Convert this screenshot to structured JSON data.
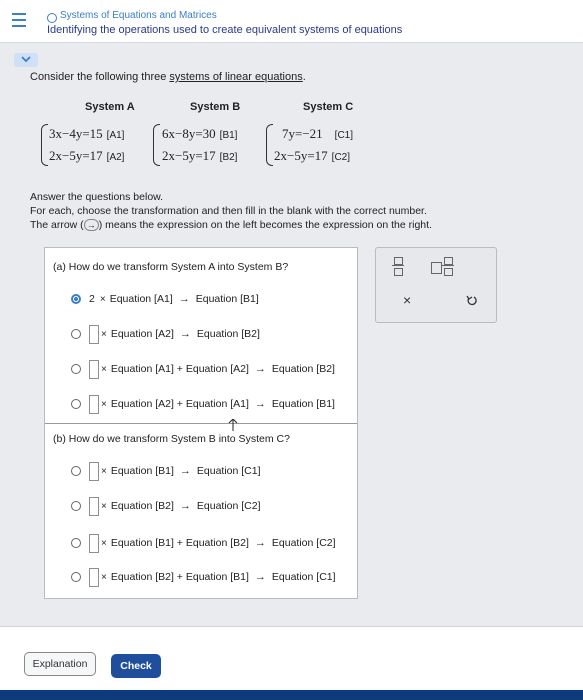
{
  "header": {
    "topic": "Systems of Equations and Matrices",
    "lesson": "Identifying the operations used to create equivalent systems of equations"
  },
  "intro": {
    "prefix": "Consider the following three ",
    "link": "systems of linear equations",
    "suffix": "."
  },
  "systems": [
    {
      "title": "System A",
      "eq1": "3x−4y=15",
      "tag1": "[A1]",
      "eq2": "2x−5y=17",
      "tag2": "[A2]"
    },
    {
      "title": "System B",
      "eq1": "6x−8y=30",
      "tag1": "[B1]",
      "eq2": "2x−5y=17",
      "tag2": "[B2]"
    },
    {
      "title": "System C",
      "eq1": "7y=−21",
      "tag1": "[C1]",
      "eq2": "2x−5y=17",
      "tag2": "[C2]"
    }
  ],
  "instructions": {
    "line1": "Answer the questions below.",
    "line2": "For each, choose the transformation and then fill in the blank with the correct number.",
    "line3a": "The arrow (",
    "arrow": "→",
    "line3b": ") means the expression on the left becomes the expression on the right."
  },
  "part_a": {
    "label": "(a)  How do we transform System A into System B?",
    "options": [
      {
        "coef": "2",
        "times": "×",
        "left": "Equation [A1]",
        "arrow": "→",
        "right": "Equation [B1]",
        "selected": true
      },
      {
        "times": "×",
        "left": "Equation [A2]",
        "arrow": "→",
        "right": "Equation [B2]"
      },
      {
        "times": "×",
        "left": "Equation [A1] + Equation [A2]",
        "arrow": "→",
        "right": "Equation [B2]"
      },
      {
        "times": "×",
        "left": "Equation [A2] + Equation [A1]",
        "arrow": "→",
        "right": "Equation [B1]"
      }
    ]
  },
  "part_b": {
    "label": "(b)  How do we transform System B into System C?",
    "options": [
      {
        "times": "×",
        "left": "Equation [B1]",
        "arrow": "→",
        "right": "Equation [C1]"
      },
      {
        "times": "×",
        "left": "Equation [B2]",
        "arrow": "→",
        "right": "Equation [C2]"
      },
      {
        "times": "×",
        "left": "Equation [B1] + Equation [B2]",
        "arrow": "→",
        "right": "Equation [C2]"
      },
      {
        "times": "×",
        "left": "Equation [B2] + Equation [B1]",
        "arrow": "→",
        "right": "Equation [C1]"
      }
    ]
  },
  "tools": {
    "clear": "×"
  },
  "buttons": {
    "explanation": "Explanation",
    "check": "Check"
  },
  "colors": {
    "accent": "#3a7fc8",
    "check_button": "#1f4e9c",
    "bottom_bar": "#0f3a7d"
  }
}
